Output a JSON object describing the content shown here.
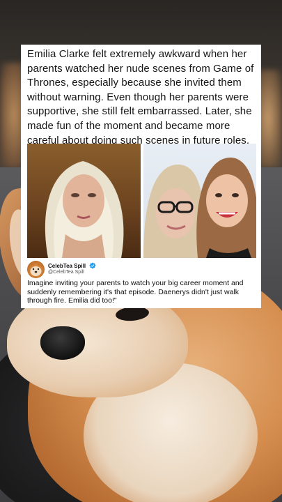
{
  "post": {
    "headline": "Emilia Clarke felt extremely awkward when her parents watched her nude scenes from Game of Thrones, especially because she invited them without warning. Even though her parents were supportive, she still felt embarrassed. Later, she made fun of the moment and became more careful about doing such scenes in future roles."
  },
  "tweet": {
    "author": "CelebTea Spill",
    "handle": "@CelebTea Spill",
    "text": "Imagine inviting your parents to watch your big career moment and suddenly remembering it's that episode. Daenerys didn't just walk through fire. Emilia did too!\"",
    "verified_icon": "verified-badge-icon"
  },
  "colors": {
    "verified": "#1d9bf0",
    "card_background": "#ffffff",
    "text": "#151515"
  }
}
